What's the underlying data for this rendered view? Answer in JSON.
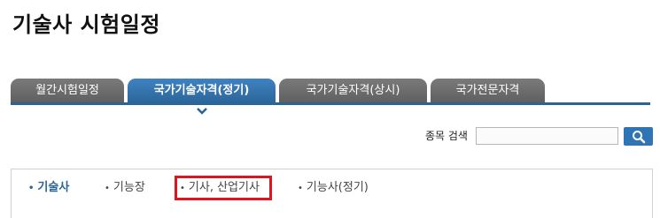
{
  "page": {
    "title": "기술사 시험일정"
  },
  "tabs": [
    {
      "label": "월간시험일정",
      "active": false
    },
    {
      "label": "국가기술자격(정기)",
      "active": true
    },
    {
      "label": "국가기술자격(상시)",
      "active": false
    },
    {
      "label": "국가전문자격",
      "active": false
    }
  ],
  "search": {
    "label": "종목 검색",
    "value": "",
    "icon": "search-icon"
  },
  "categories": [
    {
      "label": "기술사",
      "active": true
    },
    {
      "label": "기능장",
      "active": false
    },
    {
      "label": "기사, 산업기사",
      "active": false,
      "highlighted": true
    },
    {
      "label": "기능사(정기)",
      "active": false
    }
  ],
  "colors": {
    "accent": "#2a6496",
    "tab_inactive": "#666666",
    "highlight": "#e0141e",
    "search_button": "#2f74b5"
  }
}
